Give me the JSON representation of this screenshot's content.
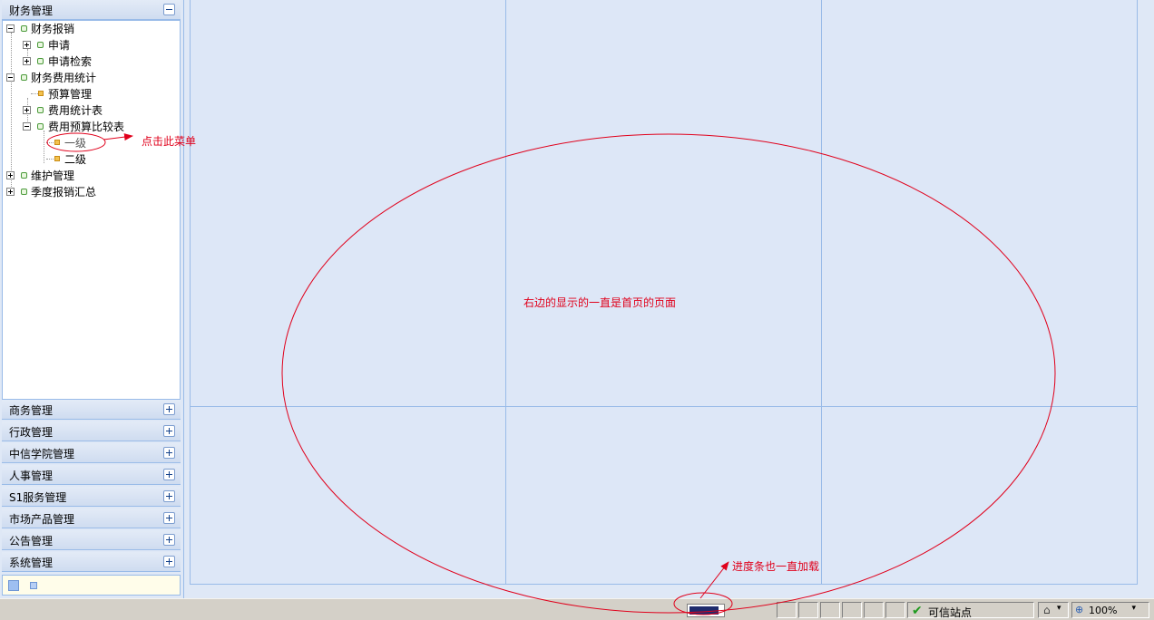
{
  "sidebar": {
    "active_panel_title": "财务管理",
    "tree": [
      {
        "label": "财务报销"
      },
      {
        "label": "申请"
      },
      {
        "label": "申请检索"
      },
      {
        "label": "财务费用统计"
      },
      {
        "label": "预算管理"
      },
      {
        "label": "费用统计表"
      },
      {
        "label": "费用预算比较表"
      },
      {
        "label": "一级"
      },
      {
        "label": "二级"
      },
      {
        "label": "维护管理"
      },
      {
        "label": "季度报销汇总"
      }
    ],
    "collapsed_panels": [
      {
        "title": "商务管理"
      },
      {
        "title": "行政管理"
      },
      {
        "title": "中信学院管理"
      },
      {
        "title": "人事管理"
      },
      {
        "title": "S1服务管理"
      },
      {
        "title": "市场产品管理"
      },
      {
        "title": "公告管理"
      },
      {
        "title": "系统管理"
      }
    ]
  },
  "annotations": {
    "click_menu": "点击此菜单",
    "main_note": "右边的显示的一直是首页的页面",
    "progress_note": "进度条也一直加载",
    "color": "#e0001b"
  },
  "statusbar": {
    "trusted_zone": "可信站点",
    "zoom": "100%",
    "progress": 0.9
  },
  "colors": {
    "panel_border": "#99bbe8",
    "background": "#dfe8f6",
    "progress": "#1e2b6d"
  }
}
